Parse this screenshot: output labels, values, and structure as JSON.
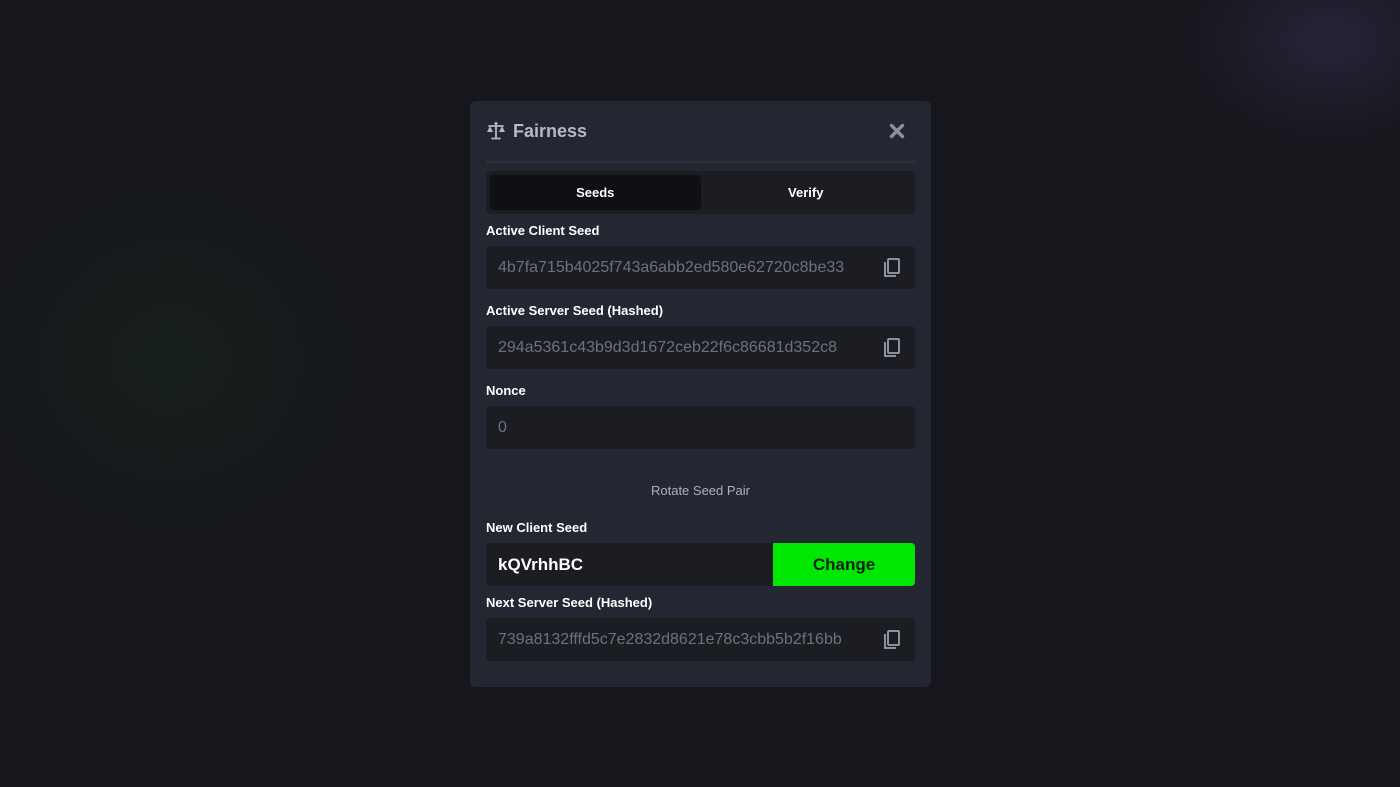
{
  "modal": {
    "title": "Fairness",
    "icon": "scale-icon",
    "close_icon": "close-icon"
  },
  "tabs": [
    {
      "label": "Seeds",
      "active": true
    },
    {
      "label": "Verify",
      "active": false
    }
  ],
  "active_client_seed": {
    "label": "Active Client Seed",
    "value": "4b7fa715b4025f743a6abb2ed580e62720c8be33"
  },
  "active_server_seed": {
    "label": "Active Server Seed (Hashed)",
    "value": "294a5361c43b9d3d1672ceb22f6c86681d352c8"
  },
  "nonce": {
    "label": "Nonce",
    "value": "0"
  },
  "rotate": {
    "label": "Rotate Seed Pair"
  },
  "new_client_seed": {
    "label": "New Client Seed",
    "value": "kQVrhhBC",
    "button_label": "Change"
  },
  "next_server_seed": {
    "label": "Next Server Seed (Hashed)",
    "value": "739a8132fffd5c7e2832d8621e78c3cbb5b2f16bb"
  },
  "colors": {
    "accent": "#00e701",
    "modal_bg": "#242731",
    "field_bg": "#1b1d23"
  }
}
